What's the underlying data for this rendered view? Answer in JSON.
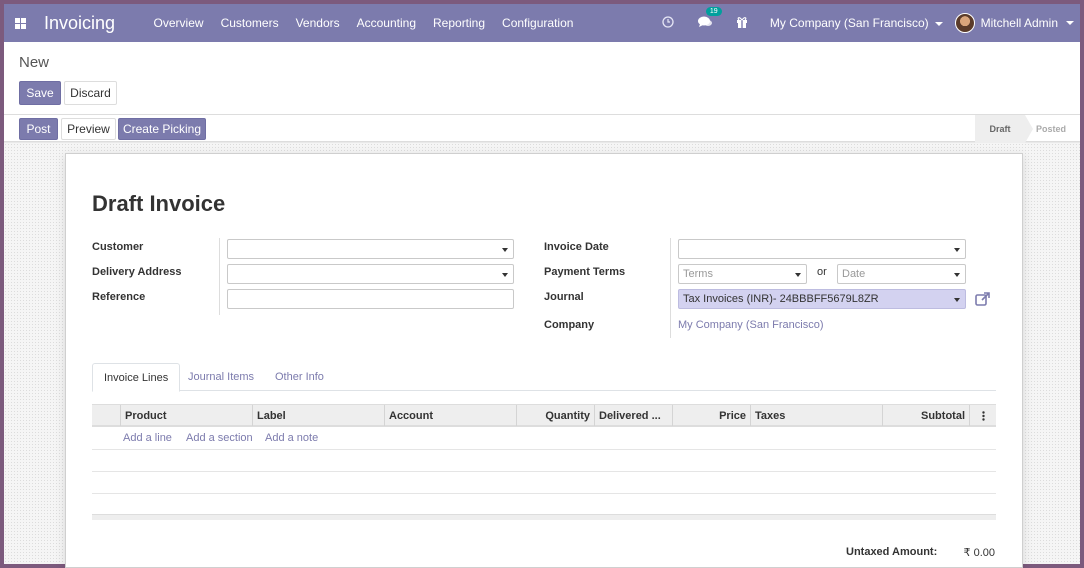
{
  "navbar": {
    "app_title": "Invoicing",
    "menu": [
      "Overview",
      "Customers",
      "Vendors",
      "Accounting",
      "Reporting",
      "Configuration"
    ],
    "messages_count": "19",
    "company": "My Company (San Francisco)",
    "user": "Mitchell Admin"
  },
  "control_panel": {
    "breadcrumb": "New",
    "save_label": "Save",
    "discard_label": "Discard",
    "post_label": "Post",
    "preview_label": "Preview",
    "create_picking_label": "Create Picking",
    "stages": [
      "Draft",
      "Posted"
    ]
  },
  "form": {
    "title": "Draft Invoice",
    "customer_label": "Customer",
    "delivery_address_label": "Delivery Address",
    "reference_label": "Reference",
    "invoice_date_label": "Invoice Date",
    "payment_terms_label": "Payment Terms",
    "terms_placeholder": "Terms",
    "or_text": "or",
    "date_placeholder": "Date",
    "journal_label": "Journal",
    "journal_value": "Tax Invoices (INR)- 24BBBFF5679L8ZR",
    "company_label": "Company",
    "company_value": "My Company (San Francisco)"
  },
  "tabs": [
    "Invoice Lines",
    "Journal Items",
    "Other Info"
  ],
  "table": {
    "columns": [
      "Product",
      "Label",
      "Account",
      "Quantity",
      "Delivered ...",
      "Price",
      "Taxes",
      "Subtotal"
    ],
    "add_line": "Add a line",
    "add_section": "Add a section",
    "add_note": "Add a note"
  },
  "totals": {
    "untaxed_label": "Untaxed Amount:",
    "untaxed_value": "₹ 0.00"
  }
}
